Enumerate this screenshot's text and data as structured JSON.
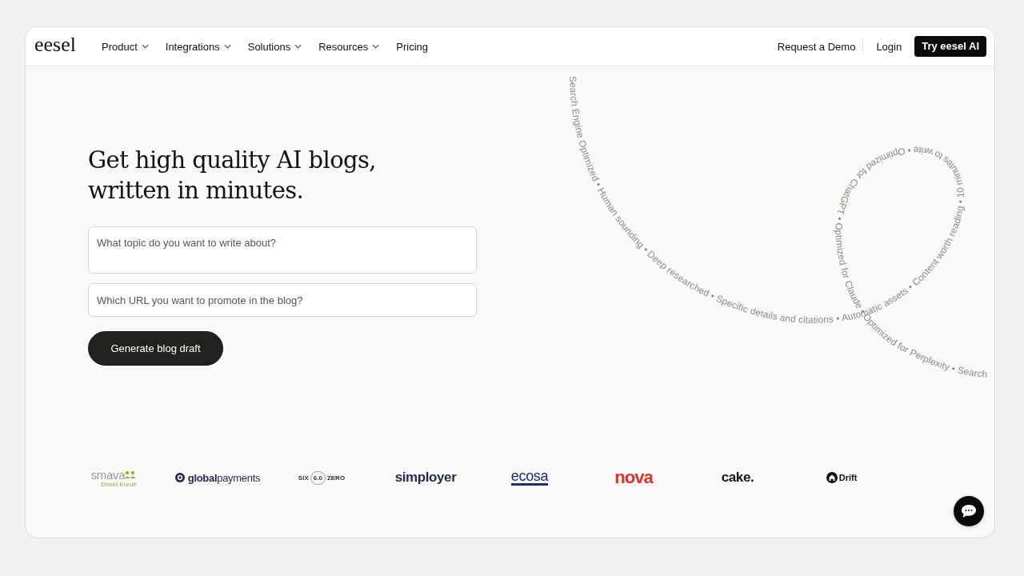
{
  "header": {
    "logo": "eesel",
    "nav": [
      {
        "label": "Product",
        "dropdown": true
      },
      {
        "label": "Integrations",
        "dropdown": true
      },
      {
        "label": "Solutions",
        "dropdown": true
      },
      {
        "label": "Resources",
        "dropdown": true
      },
      {
        "label": "Pricing",
        "dropdown": false
      }
    ],
    "links": [
      "Request a Demo",
      "Login"
    ],
    "cta": "Try eesel AI"
  },
  "hero": {
    "headline": "Get high quality AI blogs, written in minutes.",
    "topic_field": {
      "placeholder": "What topic do you want to write about?"
    },
    "url_field": {
      "placeholder": "Which URL you want to promote in the blog?"
    },
    "button": "Generate blog draft",
    "curved_text": "Search Engine Optimized • Human sounding • Deep researched • Specific details and citations • Automatic assets • Content worth reading • 10 minutes to write • Optimized for ChatGPT • Optimized for Claude • Optimized for Perplexity • Search"
  },
  "logos": [
    {
      "kind": "smava",
      "text": "smava",
      "sub": "Direkt Kredit",
      "color": "#8ab44a"
    },
    {
      "kind": "globalpayments",
      "text": "**global**payments",
      "color": "#1f2a55"
    },
    {
      "kind": "six",
      "text": "SIX",
      "badge": "6.0",
      "text2": "ZERO",
      "color": "#333333"
    },
    {
      "kind": "plain",
      "text": "simployer",
      "color": "#1f2a55"
    },
    {
      "kind": "ecosa",
      "text": "ecosa",
      "color": "#1c2f6e"
    },
    {
      "kind": "nova",
      "text": "nova",
      "color": "#e0322a"
    },
    {
      "kind": "plain",
      "text": "cake.",
      "color": "#111111"
    },
    {
      "kind": "drift",
      "text": "Drift",
      "color": "#111111"
    }
  ]
}
